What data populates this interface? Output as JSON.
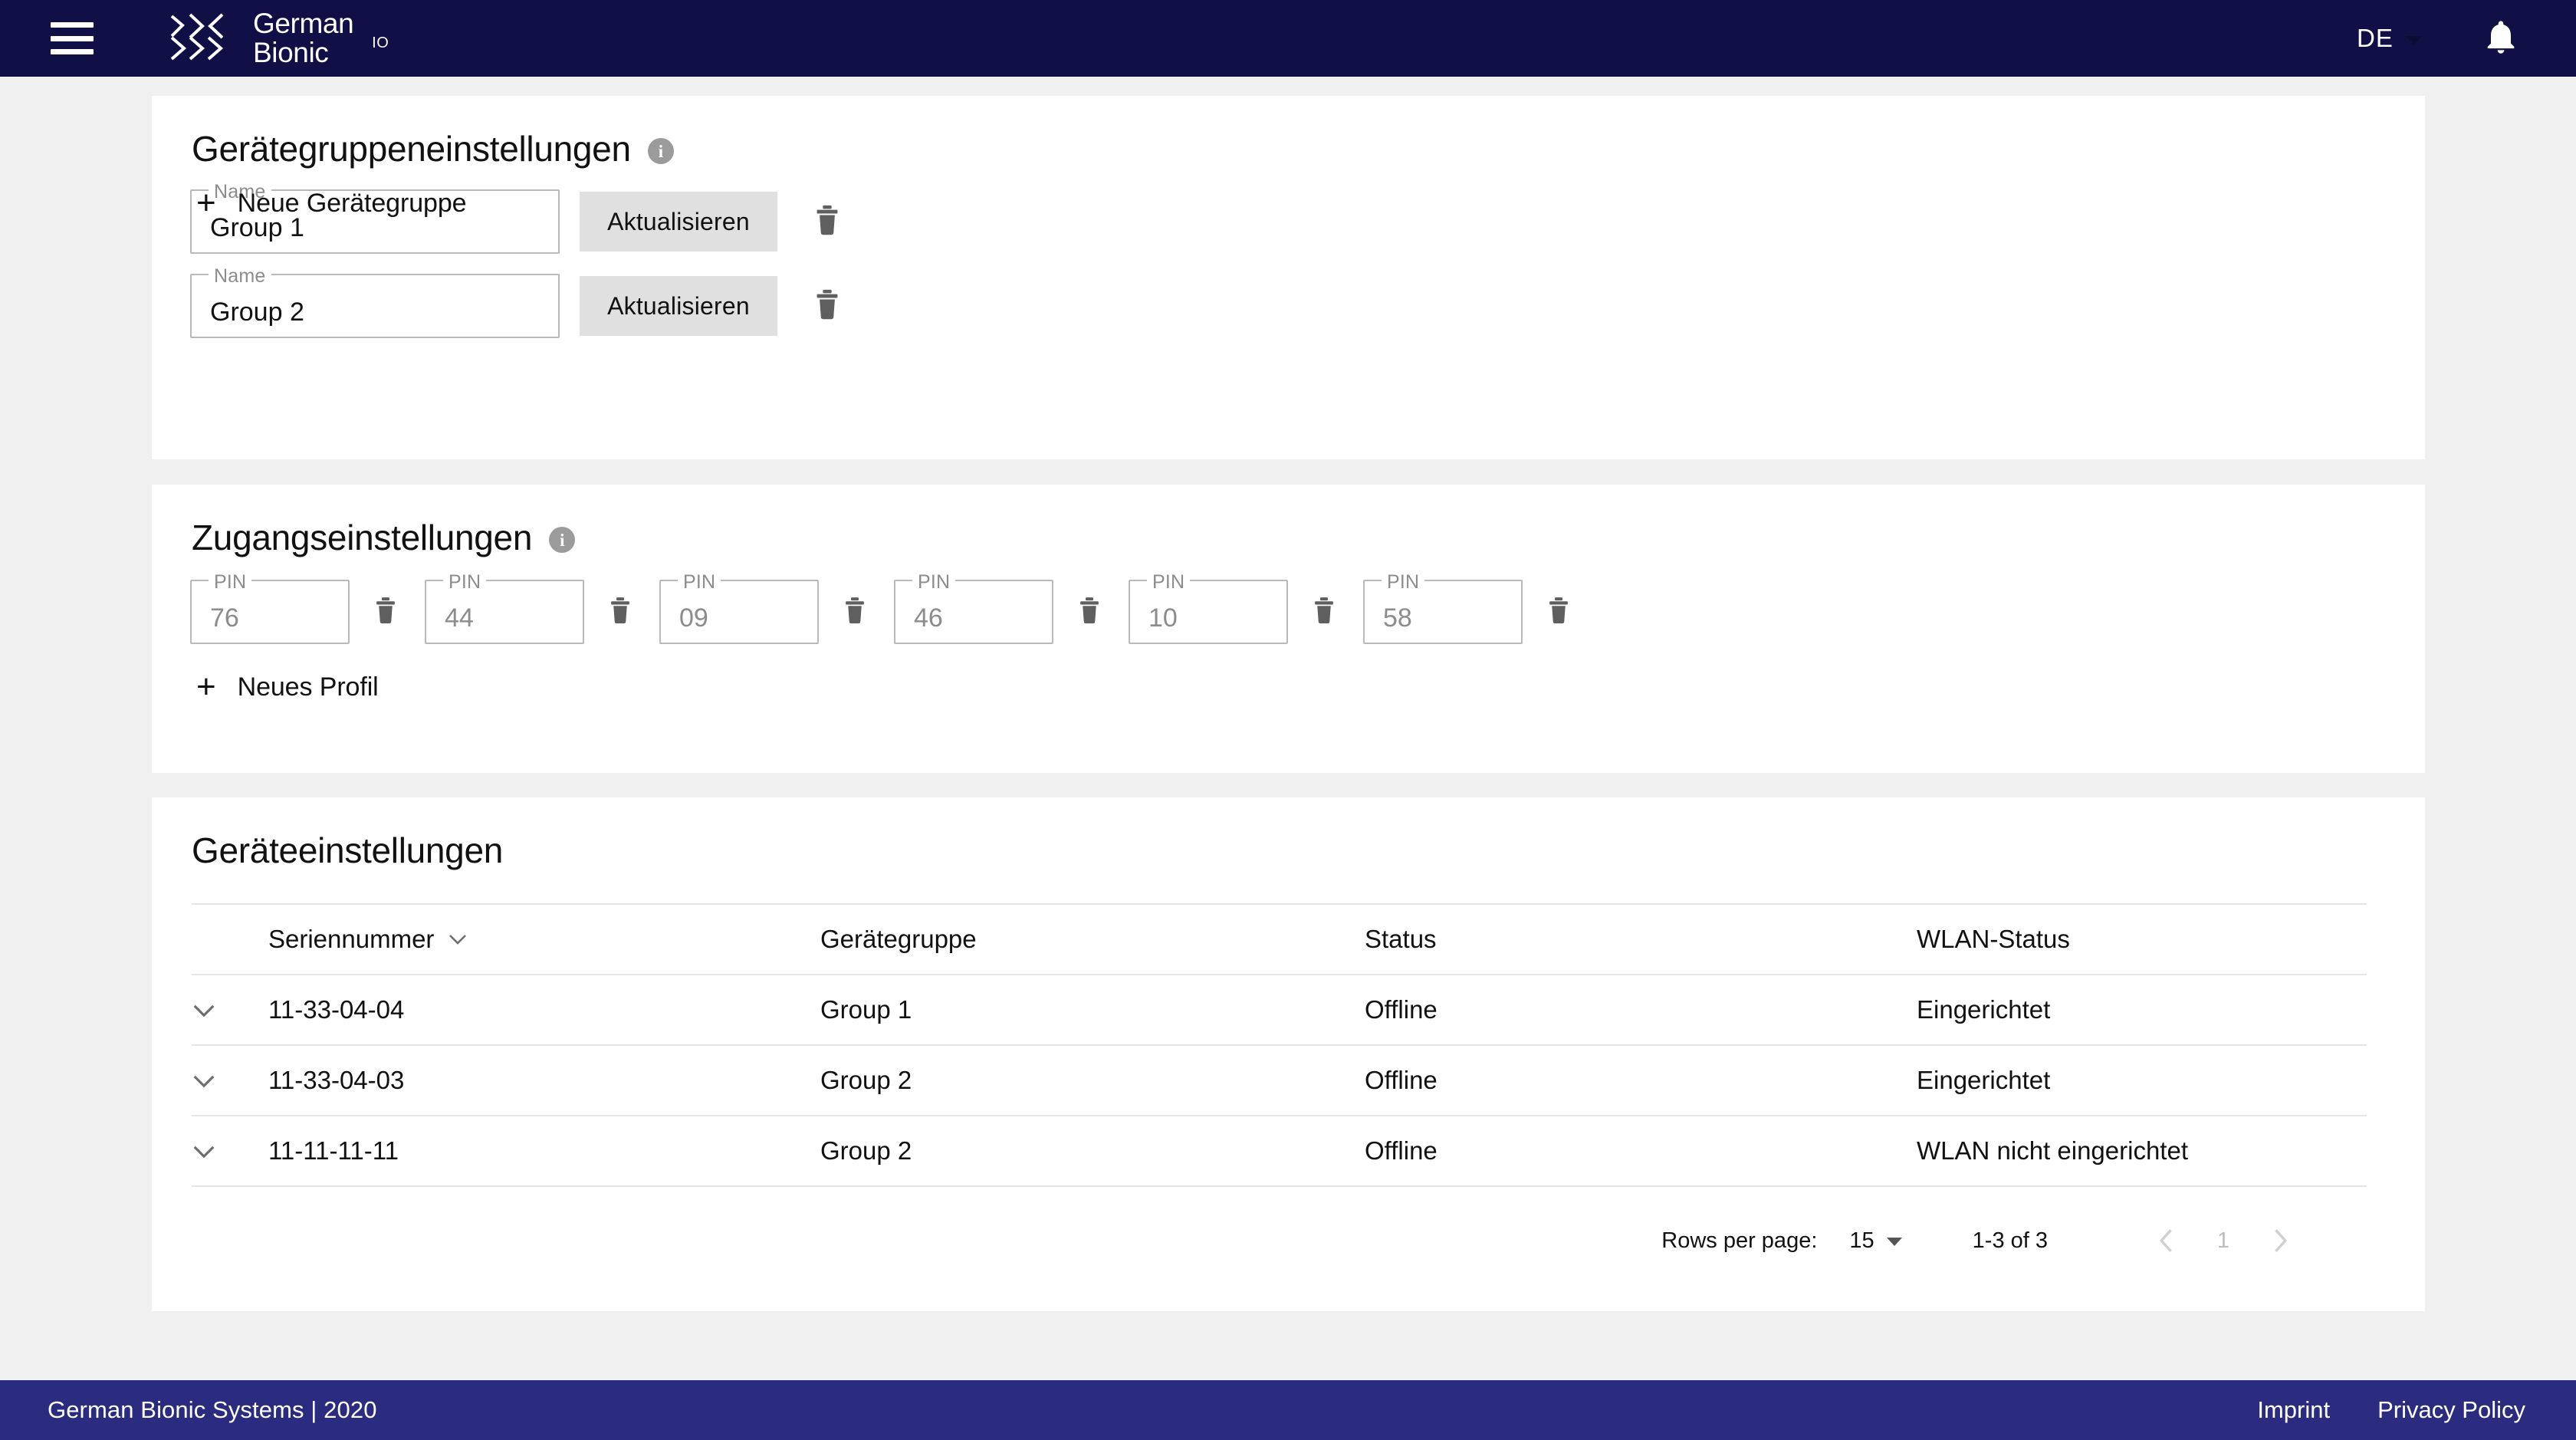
{
  "appbar": {
    "menu_icon": "hamburger-menu-icon",
    "brand_line1": "German",
    "brand_line2": "Bionic",
    "brand_suffix": "IO",
    "language": "DE",
    "language_caret_icon": "chevron-down-icon",
    "notifications_icon": "bell-icon"
  },
  "device_group_settings": {
    "title": "Gerätegruppeneinstellungen",
    "info_icon": "info-icon",
    "field_label": "Name",
    "update_label": "Aktualisieren",
    "delete_icon": "trash-icon",
    "groups": [
      {
        "name": "Group 1"
      },
      {
        "name": "Group 2"
      }
    ],
    "add_label": "Neue Gerätegruppe",
    "add_icon": "plus-icon"
  },
  "access_settings": {
    "title": "Zugangseinstellungen",
    "info_icon": "info-icon",
    "field_label": "PIN",
    "delete_icon": "trash-icon",
    "pins": [
      "76",
      "44",
      "09",
      "46",
      "10",
      "58"
    ],
    "add_label": "Neues Profil",
    "add_icon": "plus-icon"
  },
  "device_settings": {
    "title": "Geräteeinstellungen",
    "columns": {
      "serial": "Seriennummer",
      "group": "Gerätegruppe",
      "status": "Status",
      "wlan": "WLAN-Status"
    },
    "sort_icon": "chevron-down-icon",
    "row_expand_icon": "chevron-down-icon",
    "rows": [
      {
        "serial": "11-33-04-04",
        "group": "Group 1",
        "status": "Offline",
        "wlan": "Eingerichtet"
      },
      {
        "serial": "11-33-04-03",
        "group": "Group 2",
        "status": "Offline",
        "wlan": "Eingerichtet"
      },
      {
        "serial": "11-11-11-11",
        "group": "Group 2",
        "status": "Offline",
        "wlan": "WLAN nicht eingerichtet"
      }
    ],
    "pagination": {
      "rows_per_page_label": "Rows per page:",
      "rows_per_page_value": "15",
      "range": "1-3 of 3",
      "prev_icon": "chevron-left-icon",
      "page": "1",
      "next_icon": "chevron-right-icon"
    }
  },
  "footer": {
    "copyright": "German Bionic Systems | 2020",
    "imprint": "Imprint",
    "privacy": "Privacy Policy"
  },
  "colors": {
    "appbar": "#101046",
    "footer": "#2b2b80",
    "page_bg": "#f0f0f0",
    "card_bg": "#ffffff",
    "button_grey": "#e0e0e0"
  }
}
